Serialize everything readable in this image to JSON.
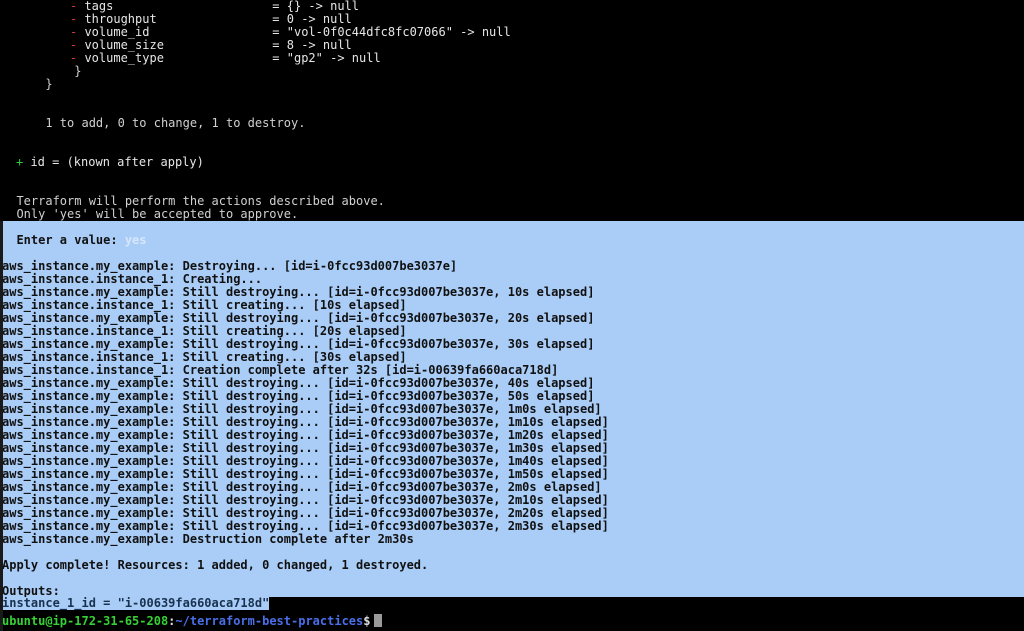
{
  "terminal": {
    "title": "terraform apply output",
    "colors": {
      "background": "#000000",
      "selection_background": "#aacdf7",
      "foreground": "#d0d0d0",
      "green": "#2ecc40",
      "red": "#cc3b3b",
      "prompt_user": "#35d135",
      "prompt_path": "#4a6fe8"
    }
  },
  "plan_pane": {
    "attribute_rows": [
      {
        "marker": "-",
        "name": "tags",
        "eq": "=",
        "old": "{}",
        "arrow": "->",
        "new": "null"
      },
      {
        "marker": "-",
        "name": "throughput",
        "eq": "=",
        "old": "0",
        "arrow": "->",
        "new": "null"
      },
      {
        "marker": "-",
        "name": "volume_id",
        "eq": "=",
        "old": "\"vol-0f0c44dfc8fc07066\"",
        "arrow": "->",
        "new": "null"
      },
      {
        "marker": "-",
        "name": "volume_size",
        "eq": "=",
        "old": "8",
        "arrow": "->",
        "new": "null"
      },
      {
        "marker": "-",
        "name": "volume_type",
        "eq": "=",
        "old": "\"gp2\"",
        "arrow": "->",
        "new": "null"
      }
    ],
    "close_inner": "}",
    "close_outer": "}",
    "plan_summary": "1 to add, 0 to change, 1 to destroy.",
    "id_marker": "+",
    "id_line": "id = (known after apply)",
    "confirm_line_1": "Terraform will perform the actions described above.",
    "confirm_line_2": "Only 'yes' will be accepted to approve."
  },
  "apply_pane": {
    "enter_prompt": "Enter a value:",
    "entered_value": "yes",
    "log_lines": [
      "aws_instance.my_example: Destroying... [id=i-0fcc93d007be3037e]",
      "aws_instance.instance_1: Creating...",
      "aws_instance.my_example: Still destroying... [id=i-0fcc93d007be3037e, 10s elapsed]",
      "aws_instance.instance_1: Still creating... [10s elapsed]",
      "aws_instance.my_example: Still destroying... [id=i-0fcc93d007be3037e, 20s elapsed]",
      "aws_instance.instance_1: Still creating... [20s elapsed]",
      "aws_instance.my_example: Still destroying... [id=i-0fcc93d007be3037e, 30s elapsed]",
      "aws_instance.instance_1: Still creating... [30s elapsed]",
      "aws_instance.instance_1: Creation complete after 32s [id=i-00639fa660aca718d]",
      "aws_instance.my_example: Still destroying... [id=i-0fcc93d007be3037e, 40s elapsed]",
      "aws_instance.my_example: Still destroying... [id=i-0fcc93d007be3037e, 50s elapsed]",
      "aws_instance.my_example: Still destroying... [id=i-0fcc93d007be3037e, 1m0s elapsed]",
      "aws_instance.my_example: Still destroying... [id=i-0fcc93d007be3037e, 1m10s elapsed]",
      "aws_instance.my_example: Still destroying... [id=i-0fcc93d007be3037e, 1m20s elapsed]",
      "aws_instance.my_example: Still destroying... [id=i-0fcc93d007be3037e, 1m30s elapsed]",
      "aws_instance.my_example: Still destroying... [id=i-0fcc93d007be3037e, 1m40s elapsed]",
      "aws_instance.my_example: Still destroying... [id=i-0fcc93d007be3037e, 1m50s elapsed]",
      "aws_instance.my_example: Still destroying... [id=i-0fcc93d007be3037e, 2m0s elapsed]",
      "aws_instance.my_example: Still destroying... [id=i-0fcc93d007be3037e, 2m10s elapsed]",
      "aws_instance.my_example: Still destroying... [id=i-0fcc93d007be3037e, 2m20s elapsed]",
      "aws_instance.my_example: Still destroying... [id=i-0fcc93d007be3037e, 2m30s elapsed]",
      "aws_instance.my_example: Destruction complete after 2m30s"
    ],
    "apply_complete": "Apply complete! Resources: 1 added, 0 changed, 1 destroyed.",
    "outputs_header": "Outputs:",
    "output_value_line": "instance_1_id = \"i-00639fa660aca718d\""
  },
  "prompt": {
    "user_host": "ubuntu@ip-172-31-65-208",
    "colon": ":",
    "path": "~/terraform-best-practices",
    "dollar": "$",
    "cursor": "block-cursor"
  }
}
